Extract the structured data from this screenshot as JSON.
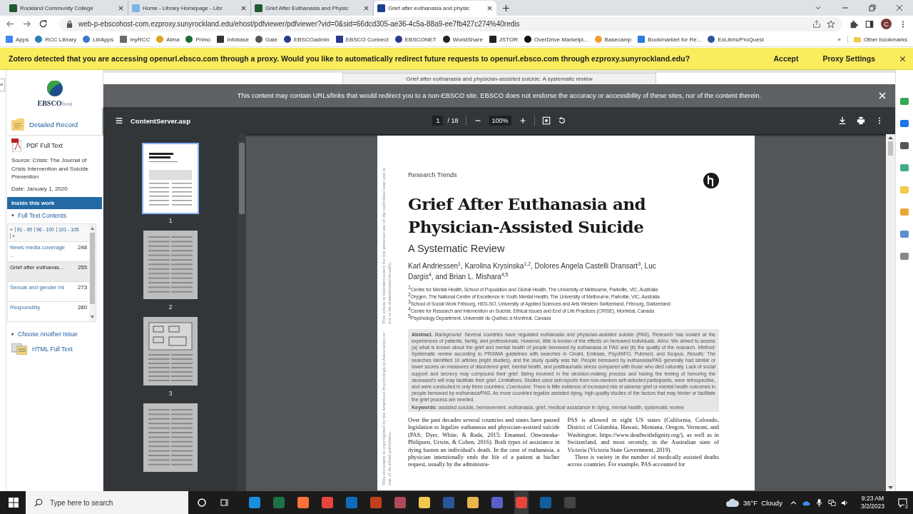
{
  "browser": {
    "tabs": [
      {
        "title": "Rockland Community College",
        "selected": false
      },
      {
        "title": "Home - Library Homepage - Libr",
        "selected": false
      },
      {
        "title": "Grief After Euthanasia and Physic",
        "selected": false
      },
      {
        "title": "Grief after euthanasia and physic",
        "selected": true
      }
    ],
    "url": "web-p-ebscohost-com.ezproxy.sunyrockland.edu/ehost/pdfviewer/pdfviewer?vid=0&sid=66dcd305-ae36-4c5a-88a9-ee7fb427c274%40redis",
    "profile_initial": "C",
    "bookmarks": [
      "Apps",
      "RCC Library",
      "LibApps",
      "myRCC",
      "Alma",
      "Primo",
      "Infobase",
      "Gale",
      "EBSCOadmin",
      "EBSCO Connect",
      "EBSCONET",
      "WorldShare",
      "JSTOR",
      "OverDrive Marketpl...",
      "Basecamp",
      "Bookmarklet for Re...",
      "ExLibris/ProQuest"
    ],
    "more_bookmarks": "»",
    "other_bookmarks": "Other bookmarks"
  },
  "zotero_bar": {
    "message": "Zotero detected that you are accessing openurl.ebsco.com through a proxy. Would you like to automatically redirect future requests to openurl.ebsco.com through ezproxy.sunyrockland.edu?",
    "actions": [
      "Accept",
      "Proxy Settings"
    ]
  },
  "sidebar": {
    "collapse": "«",
    "logo": {
      "brand": "EBSCO",
      "suffix": "host"
    },
    "detailed_record": "Detailed Record",
    "pdf_full_text": "PDF Full Text",
    "source": "Source: Crisis: The Journal of Crisis Intervention and Suicide Prevention",
    "date": "Date: January 1, 2020",
    "section_title": "Inside this work",
    "contents": {
      "label": "Full Text Contents",
      "expanded": true
    },
    "pager": {
      "prev": "«",
      "ranges": [
        "91 - 95",
        "96 - 100",
        "101 - 105"
      ],
      "next": "»"
    },
    "items": [
      {
        "title": "News media coverage ...",
        "page": "248",
        "selected": false
      },
      {
        "title": "Grief after euthanas...",
        "page": "255",
        "selected": true
      },
      {
        "title": "Sexual and gender mi",
        "page": "273",
        "selected": false
      },
      {
        "title": "Responsibly",
        "page": "280",
        "selected": false
      }
    ],
    "choose_issue": {
      "label": "Choose Another Issue",
      "expanded": false
    },
    "html_full_text": "HTML Full Text"
  },
  "viewer": {
    "doc_title": "Grief after euthanasia and physician-assisted suicide: A systematic review",
    "notice": "This content may contain URLs/links that would redirect you to a non-EBSCO site. EBSCO does not endorse the accuracy or accessibility of these sites, nor of the content therein.",
    "toolbar": {
      "filename": "ContentServer.asp",
      "page": "1",
      "page_count": "/ 18",
      "zoom": "100%"
    },
    "thumbnails": [
      {
        "kind": "cover",
        "label": "1",
        "selected": true
      },
      {
        "kind": "text",
        "label": "2",
        "selected": false
      },
      {
        "kind": "figure",
        "label": "3",
        "selected": false
      },
      {
        "kind": "text",
        "selected": false
      }
    ]
  },
  "page": {
    "section": "Research Trends",
    "title": "Grief After Euthanasia and Physician-Assisted Suicide",
    "subtitle": "A Systematic Review",
    "authors": "Karl Andriessen$^{1}$, Karolina Krysinska$^{1,2}$, Dolores Angela Castelli Dransart$^{3}$, Luc Dargis$^{4}$, and Brian L. Mishara$^{4,5}$",
    "affiliations": [
      "$^{1}$Centre for Mental Health, School of Population and Global Health, The University of Melbourne, Parkville, VIC, Australia",
      "$^{2}$Orygen, The National Centre of Excellence in Youth Mental Health, The University of Melbourne, Parkville, VIC, Australia",
      "$^{3}$School of Social Work Fribourg, HES-SO, University of Applied Sciences and Arts Western Switzerland, Fribourg, Switzerland",
      "$^{4}$Centre for Research and Intervention on Suicide, Ethical Issues and End of Life Practices (CRISE), Montréal, Canada",
      "$^{5}$Psychology Department, Université du Québec à Montréal, Canada"
    ],
    "abstract": "**Abstract.** *Background:* Several countries have regulated euthanasia and physician-assisted suicide (PAS). Research has looked at the experiences of patients, family, and professionals. However, little is known of the effects on bereaved individuals. *Aims:* We aimed to assess (a) what is known about the grief and mental health of people bereaved by euthanasia or PAS and (b) the quality of the research. *Method:* Systematic review according to PRISMA guidelines with searches in Cinahl, Embase, PsycINFO, Pubmed, and Scopus. *Results:* The searches identified 10 articles (eight studies), and the study quality was fair. People bereaved by euthanasia/PAS generally had similar or lower scores on measures of disordered grief, mental health, and posttraumatic stress compared with those who died naturally. Lack of social support and secrecy may compound their grief. Being involved in the decision-making process and having the feeling of honoring the deceased's will may facilitate their grief. *Limitations:* Studies used self-reports from non-random self-selected participants, were retrospective, and were conducted in only three countries. *Conclusion:* There is little evidence of increased risk of adverse grief or mental health outcomes in people bereaved by euthanasia/PAS. As more countries legalize assisted dying, high-quality studies of the factors that may hinder or facilitate the grief process are needed.",
    "keywords": "**Keywords:** assisted suicide, bereavement, euthanasia, grief, medical assistance in dying, mental health, systematic review",
    "columns": [
      [
        "Over the past decades several countries and states have passed legislation to legalize euthanasia and physician-assisted suicide (PAS; Dyer, White, & Rada, 2015; Emanuel, Onwuteaka-Philipsen, Urwin, & Cohen, 2016). Both types of assistance in dying hasten an individual's death. In the case of euthanasia, a physician intentionally ends the life of a patient at his/her request, usually by the administra-"
      ],
      [
        "PAS is allowed in eight US states (California, Colorado, District of Columbia, Hawaii, Montana, Oregon, Vermont, and Washington; https://www.deathwithdignity.org/), as well as in Switzerland, and most recently, in the Australian state of Victoria (Victoria State Government, 2019).",
        "There is variety in the number of medically assisted deaths across countries. For example, PAS accounted for"
      ]
    ],
    "copyright": [
      "This document is copyrighted by the American Psychological Association or one of its allied publishers.",
      "This article is intended solely for the personal use of the individual user and is not to be disseminated broadly."
    ]
  },
  "taskbar": {
    "search_placeholder": "Type here to search",
    "weather": "36°F  Cloudy",
    "time": "9:23 AM",
    "date": "3/2/2023",
    "notifications": "2"
  }
}
